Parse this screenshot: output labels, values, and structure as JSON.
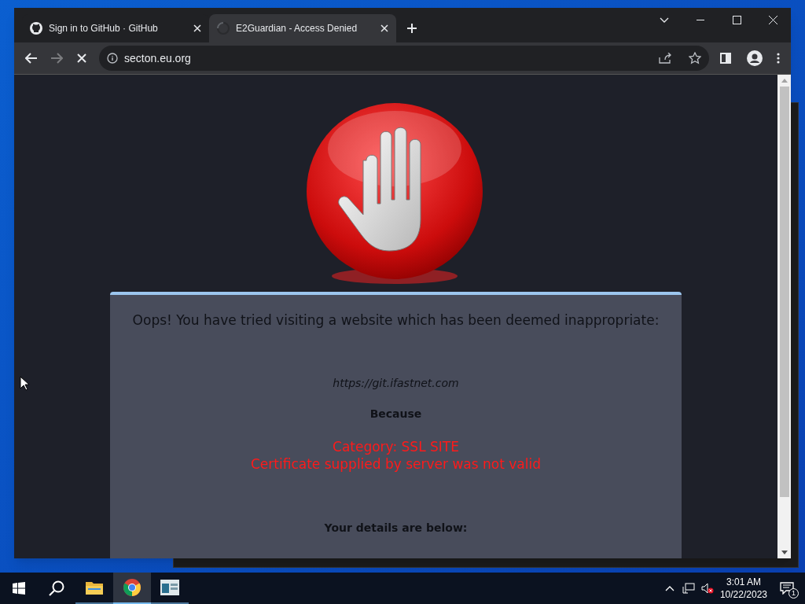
{
  "browser": {
    "tabs": [
      {
        "title": "Sign in to GitHub · GitHub",
        "kind": "github",
        "selected": false
      },
      {
        "title": "E2Guardian - Access Denied",
        "kind": "loading",
        "selected": true
      }
    ],
    "address": "secton.eu.org"
  },
  "page": {
    "heading": "Oops! You have tried visiting a website which has been deemed inappropriate:",
    "url": "https://git.ifastnet.com",
    "because": "Because",
    "reasons": [
      "Category: SSL SITE",
      "Certificate supplied by server was not valid"
    ],
    "details_heading": "Your details are below:"
  },
  "taskbar": {
    "apps": [
      {
        "kind": "explorer",
        "selected": false
      },
      {
        "kind": "chrome",
        "selected": true
      },
      {
        "kind": "window",
        "selected": false
      }
    ],
    "time": "3:01 AM",
    "date": "10/22/2023",
    "notifications": "1"
  }
}
